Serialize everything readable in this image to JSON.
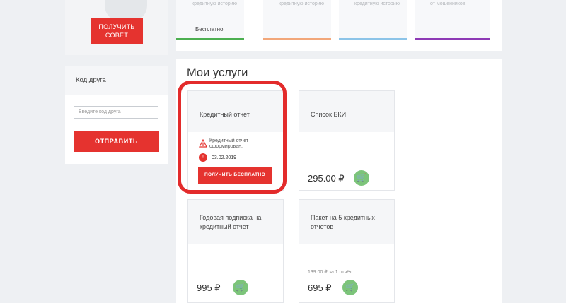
{
  "promo": {
    "button_label": "ПОЛУЧИТЬ\nСОВЕТ"
  },
  "friend": {
    "title": "Код друга",
    "input_placeholder": "Введите код друга",
    "submit_label": "ОТПРАВИТЬ"
  },
  "top_tiles": [
    {
      "caption": "кредитную историю",
      "value": "Бесплатно",
      "color": "#4caf50"
    },
    {
      "caption": "кредитную историю",
      "value": "",
      "color": "#f2a77a"
    },
    {
      "caption": "кредитную историю",
      "value": "",
      "color": "#8cc4e8"
    },
    {
      "caption": "от мошенников",
      "value": "",
      "color": "#8e3ab5"
    }
  ],
  "services": {
    "title": "Мои услуги",
    "cards": [
      {
        "title": "Кредитный отчет",
        "status_line1": "Кредитный отчет",
        "status_line2": "сформирован.",
        "date": "03.02.2019",
        "action_label": "ПОЛУЧИТЬ БЕСПЛАТНО"
      },
      {
        "title": "Список БКИ",
        "price": "295.00 ₽"
      },
      {
        "title_line1": "Годовая подписка на",
        "title_line2": "кредитный отчет",
        "price": "995 ₽"
      },
      {
        "title_line1": "Пакет на 5 кредитных",
        "title_line2": "отчетов",
        "note": "139.00 ₽ за 1 отчёт",
        "price": "695 ₽"
      }
    ]
  },
  "colors": {
    "accent": "#e5332f",
    "cart": "#7cc47a",
    "highlight": "#e32b2b"
  },
  "icons": {
    "cart": "shopping-cart-icon",
    "warning": "warning-triangle-icon",
    "status": "status-dot-icon"
  }
}
